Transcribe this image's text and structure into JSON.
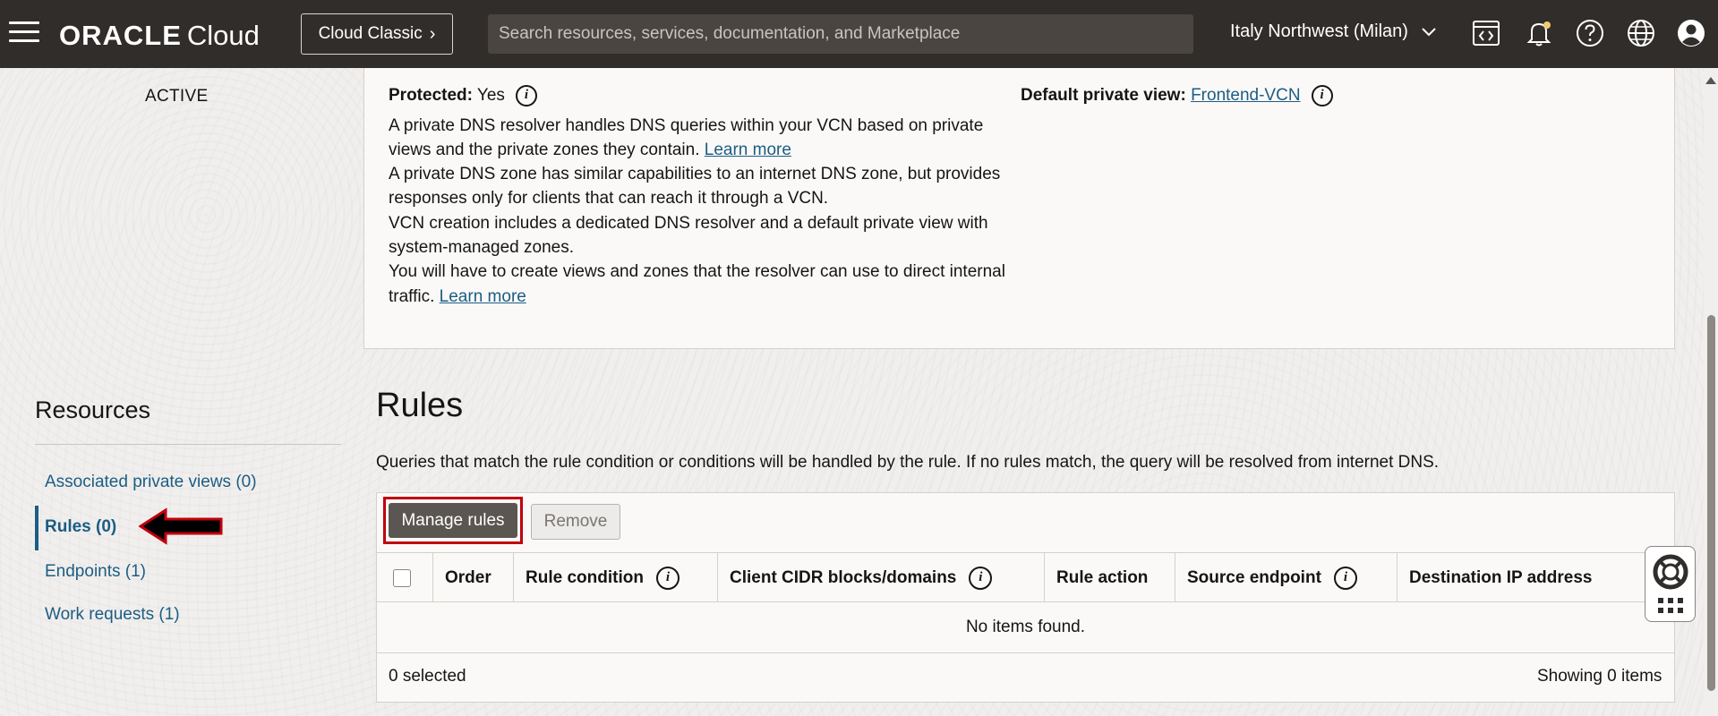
{
  "header": {
    "brand": "ORACLE",
    "product": "Cloud",
    "classic_button": "Cloud Classic",
    "search_placeholder": "Search resources, services, documentation, and Marketplace",
    "region": "Italy Northwest (Milan)"
  },
  "left": {
    "status": "ACTIVE",
    "resources_title": "Resources",
    "links": [
      {
        "label": "Associated private views (0)"
      },
      {
        "label": "Rules (0)"
      },
      {
        "label": "Endpoints (1)"
      },
      {
        "label": "Work requests (1)"
      }
    ]
  },
  "info": {
    "protected_label": "Protected:",
    "protected_value": "Yes",
    "default_view_label": "Default private view:",
    "default_view_value": "Frontend-VCN",
    "para1_line1": "A private DNS resolver handles DNS queries within your VCN based on private",
    "para1_line2": "views and the private zones they contain.",
    "learn_more": "Learn more",
    "para2_line1": "A private DNS zone has similar capabilities to an internet DNS zone, but provides",
    "para2_line2": "responses only for clients that can reach it through a VCN.",
    "para3_line1": "VCN creation includes a dedicated DNS resolver and a default private view with",
    "para3_line2": "system-managed zones.",
    "para4_line1": "You will have to create views and zones that the resolver can use to direct internal",
    "para4_line2": "traffic."
  },
  "rules": {
    "title": "Rules",
    "description": "Queries that match the rule condition or conditions will be handled by the rule. If no rules match, the query will be resolved from internet DNS.",
    "manage_button": "Manage rules",
    "remove_button": "Remove",
    "columns": [
      "Order",
      "Rule condition",
      "Client CIDR blocks/domains",
      "Rule action",
      "Source endpoint",
      "Destination IP address"
    ],
    "empty_message": "No items found.",
    "selected_text": "0 selected",
    "showing_text": "Showing 0 items"
  },
  "colors": {
    "header_bg": "#312d2a",
    "link": "#1c5d84",
    "highlight": "#c0000b"
  }
}
